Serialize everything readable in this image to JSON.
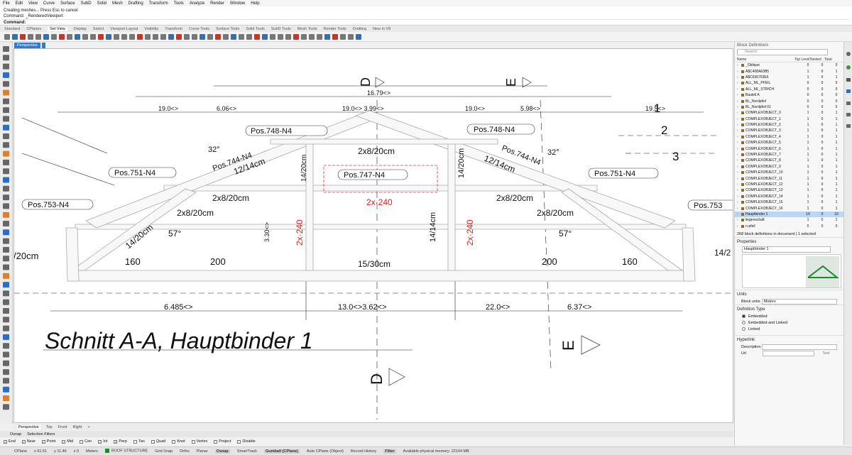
{
  "menu": [
    "File",
    "Edit",
    "View",
    "Curve",
    "Surface",
    "SubD",
    "Solid",
    "Mesh",
    "Drafting",
    "Transform",
    "Tools",
    "Analyze",
    "Render",
    "Window",
    "Help"
  ],
  "command_history": [
    "Creating meshes... Press Esc to cancel",
    "Command: _RenderedViewport"
  ],
  "command_prompt": "Command:",
  "toolbar_tabs": [
    "Standard",
    "CPlanes",
    "Set View",
    "Display",
    "Select",
    "Viewport Layout",
    "Visibility",
    "Transform",
    "Curve Tools",
    "Surface Tools",
    "Solid Tools",
    "SubD Tools",
    "Mesh Tools",
    "Render Tools",
    "Drafting",
    "New in V8"
  ],
  "active_toolbar_tab": "Set View",
  "viewport_title": "Perspective",
  "drawing": {
    "title": "Schnitt A-A, Hauptbinder 1",
    "section_marks": [
      "D",
      "E",
      "E",
      "D",
      "1",
      "2",
      "3"
    ],
    "labels": [
      "Pos.748-N4",
      "Pos.748-N4",
      "Pos.744-N4",
      "Pos.744-N4",
      "Pos.751-N4",
      "Pos.751-N4",
      "Pos.747-N4",
      "Pos.753-N4",
      "Pos.753"
    ],
    "members": [
      "2x8/20cm",
      "12/14cm",
      "12/14cm",
      "14/20cm",
      "14/20cm",
      "2x8/20cm",
      "2x8/20cm",
      "2x8/20cm",
      "2x8/20cm",
      "14/14cm",
      "15/30cm",
      "3.30<>",
      "14/20cm",
      "/20cm",
      "14/2"
    ],
    "red_labels": [
      "2x·240",
      "2x·240",
      "2x·240"
    ],
    "angles": [
      "32°",
      "32°",
      "57°",
      "57°"
    ],
    "dims_top": [
      "16.79<>",
      "19.0<>",
      "6.06<>",
      "19.0<> 3.99<>",
      "19.0<>",
      "5.98<>",
      "19.5<>"
    ],
    "dims_bottom": [
      "6.485<>",
      "13.0<>3.62<>",
      "22.0<>",
      "6.37<>"
    ],
    "dims_small": [
      "160",
      "200",
      "200",
      "160"
    ]
  },
  "viewport_tabs": [
    "Perspective",
    "Top",
    "Front",
    "Right"
  ],
  "osnap_tabs": [
    "Osnap",
    "Selection Filters"
  ],
  "osnap": [
    {
      "label": "End",
      "checked": true
    },
    {
      "label": "Near",
      "checked": true
    },
    {
      "label": "Point",
      "checked": true
    },
    {
      "label": "Mid",
      "checked": true
    },
    {
      "label": "Cen",
      "checked": false
    },
    {
      "label": "Int",
      "checked": true
    },
    {
      "label": "Perp",
      "checked": true
    },
    {
      "label": "Tan",
      "checked": false
    },
    {
      "label": "Quad",
      "checked": false
    },
    {
      "label": "Knot",
      "checked": false
    },
    {
      "label": "Vertex",
      "checked": false
    },
    {
      "label": "Project",
      "checked": false
    },
    {
      "label": "Disable",
      "checked": false
    }
  ],
  "status": {
    "cplane": "CPlane",
    "x": "x 61.51",
    "y": "y 11.46",
    "z": "z 0",
    "units": "Meters",
    "layer": "ROOF STRUCTURE",
    "layer_color": "#1a8c2c",
    "toggles": [
      "Grid Snap",
      "Ortho",
      "Planar",
      "Osnap",
      "SmartTrack",
      "Gumball (CPlane)",
      "Auto CPlane (Object)",
      "Record History",
      "Filter"
    ],
    "memory": "Available physical memory: 22104 MB"
  },
  "blocks_panel": {
    "title": "Block Definitions",
    "search_placeholder": "Search",
    "columns": [
      "Name",
      "Top Level",
      "Nested",
      "Total"
    ],
    "rows": [
      {
        "name": "_Oblique",
        "top": "0",
        "nested": "0",
        "total": "0"
      },
      {
        "name": "A$C408A63B5",
        "top": "1",
        "nested": "0",
        "total": "1"
      },
      {
        "name": "A$C636763E6",
        "top": "1",
        "nested": "0",
        "total": "1"
      },
      {
        "name": "ALL_ML_PFEIL",
        "top": "0",
        "nested": "0",
        "total": "0"
      },
      {
        "name": "ALL_ML_STRICH",
        "top": "0",
        "nested": "0",
        "total": "0"
      },
      {
        "name": "Bauteil A",
        "top": "0",
        "nested": "0",
        "total": "0"
      },
      {
        "name": "BL_Nordpfeil",
        "top": "0",
        "nested": "0",
        "total": "0"
      },
      {
        "name": "BL_Nordpfeil 01",
        "top": "0",
        "nested": "0",
        "total": "0"
      },
      {
        "name": "COMPLEXOBJECT_0",
        "top": "1",
        "nested": "0",
        "total": "1"
      },
      {
        "name": "COMPLEXOBJECT_1",
        "top": "1",
        "nested": "0",
        "total": "1"
      },
      {
        "name": "COMPLEXOBJECT_2",
        "top": "1",
        "nested": "0",
        "total": "1"
      },
      {
        "name": "COMPLEXOBJECT_3",
        "top": "1",
        "nested": "0",
        "total": "1"
      },
      {
        "name": "COMPLEXOBJECT_4",
        "top": "1",
        "nested": "0",
        "total": "1"
      },
      {
        "name": "COMPLEXOBJECT_5",
        "top": "1",
        "nested": "0",
        "total": "1"
      },
      {
        "name": "COMPLEXOBJECT_6",
        "top": "1",
        "nested": "0",
        "total": "1"
      },
      {
        "name": "COMPLEXOBJECT_7",
        "top": "1",
        "nested": "0",
        "total": "1"
      },
      {
        "name": "COMPLEXOBJECT_8",
        "top": "1",
        "nested": "0",
        "total": "1"
      },
      {
        "name": "COMPLEXOBJECT_9",
        "top": "1",
        "nested": "0",
        "total": "1"
      },
      {
        "name": "COMPLEXOBJECT_10",
        "top": "1",
        "nested": "0",
        "total": "1"
      },
      {
        "name": "COMPLEXOBJECT_11",
        "top": "1",
        "nested": "0",
        "total": "1"
      },
      {
        "name": "COMPLEXOBJECT_12",
        "top": "1",
        "nested": "0",
        "total": "1"
      },
      {
        "name": "COMPLEXOBJECT_13",
        "top": "1",
        "nested": "0",
        "total": "1"
      },
      {
        "name": "COMPLEXOBJECT_14",
        "top": "1",
        "nested": "0",
        "total": "1"
      },
      {
        "name": "COMPLEXOBJECT_15",
        "top": "1",
        "nested": "0",
        "total": "1"
      },
      {
        "name": "COMPLEXOBJECT_16",
        "top": "1",
        "nested": "0",
        "total": "1"
      },
      {
        "name": "Hauptbinder 1",
        "top": "10",
        "nested": "0",
        "total": "10",
        "selected": true
      },
      {
        "name": "liegenschaft",
        "top": "1",
        "nested": "0",
        "total": "1"
      },
      {
        "name": "n-pfeil",
        "top": "0",
        "nested": "0",
        "total": "0"
      }
    ],
    "summary": "268 block definitions in document | 1 selected",
    "properties_header": "Properties",
    "properties_name": "Hauptbinder 1",
    "units_header": "Units",
    "block_units_label": "Block units",
    "block_units_value": "Meters",
    "definition_type_header": "Definition Type",
    "definition_types": [
      {
        "label": "Embedded",
        "on": true
      },
      {
        "label": "Embedded and Linked",
        "on": false
      },
      {
        "label": "Linked",
        "on": false
      }
    ],
    "hyperlink_header": "Hyperlink",
    "description_label": "Description",
    "url_label": "Url",
    "test_button": "Test"
  }
}
